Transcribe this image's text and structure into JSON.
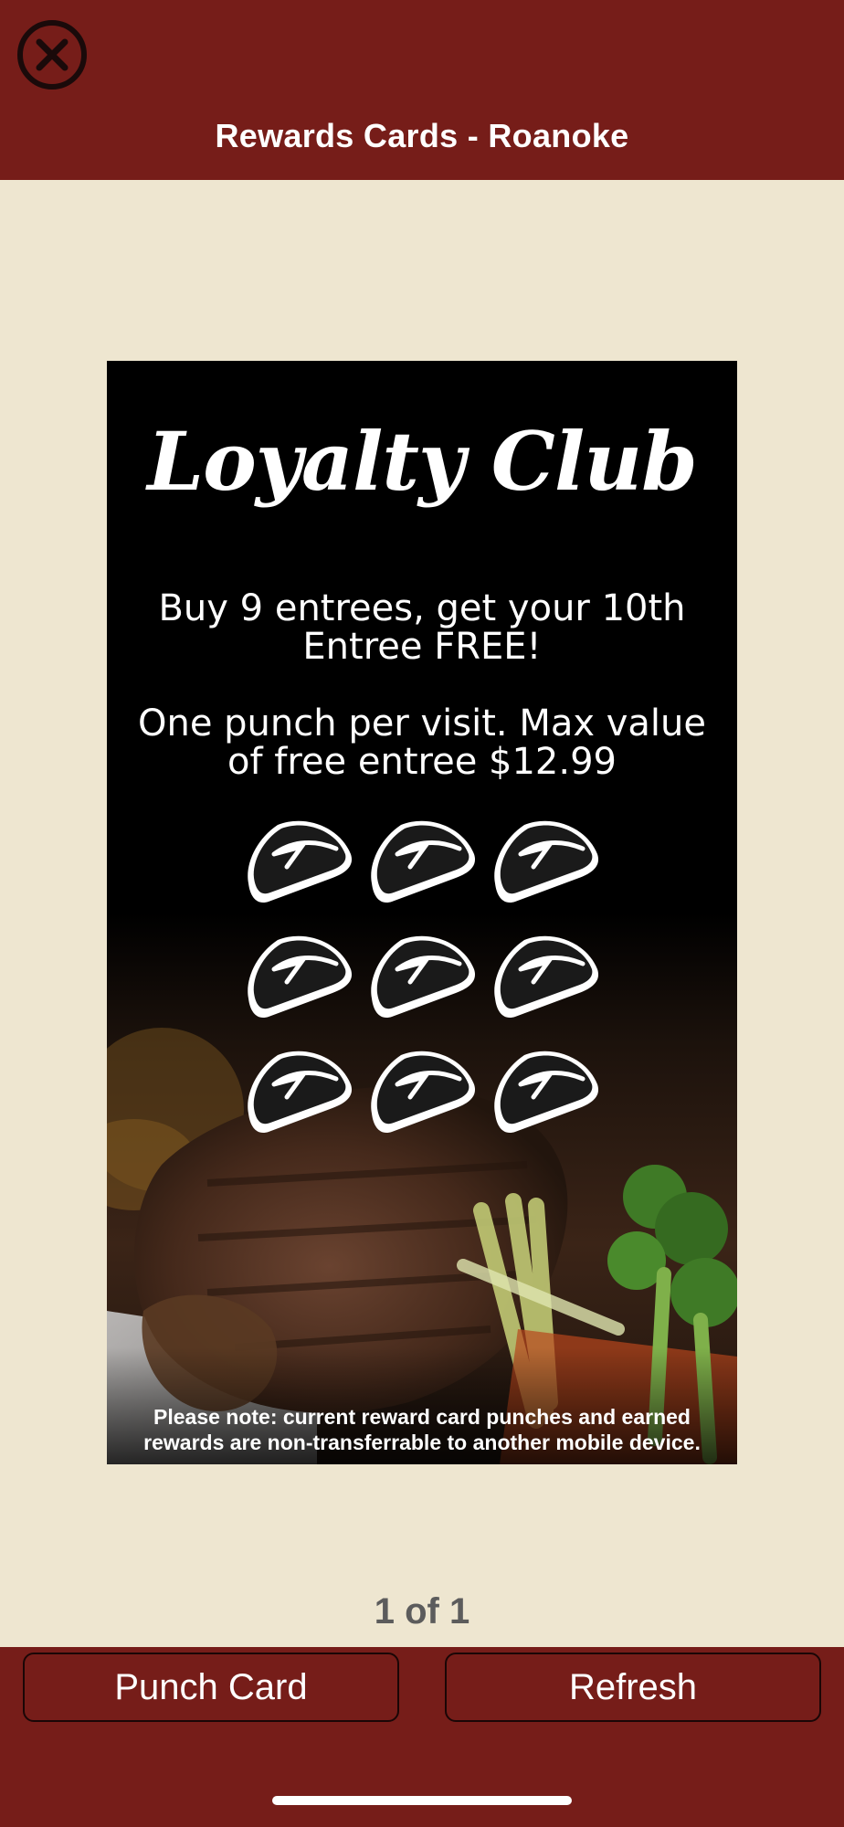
{
  "header": {
    "title": "Rewards Cards - Roanoke",
    "close_icon": "close-circle-icon"
  },
  "card": {
    "heading": "Loyalty Club",
    "offer_text": "Buy 9 entrees, get your 10th Entree FREE!",
    "rules_text": "One punch per visit. Max value of free entree $12.99",
    "punch_icon": "steak-icon",
    "note": "Please note: current reward card punches and earned rewards are non-transferrable to another mobile device."
  },
  "pager": {
    "label": "1 of 1"
  },
  "footer": {
    "punch_label": "Punch Card",
    "refresh_label": "Refresh"
  },
  "colors": {
    "brand": "#761d19",
    "background": "#eee6d0",
    "pager_text": "#5c5c5c"
  }
}
